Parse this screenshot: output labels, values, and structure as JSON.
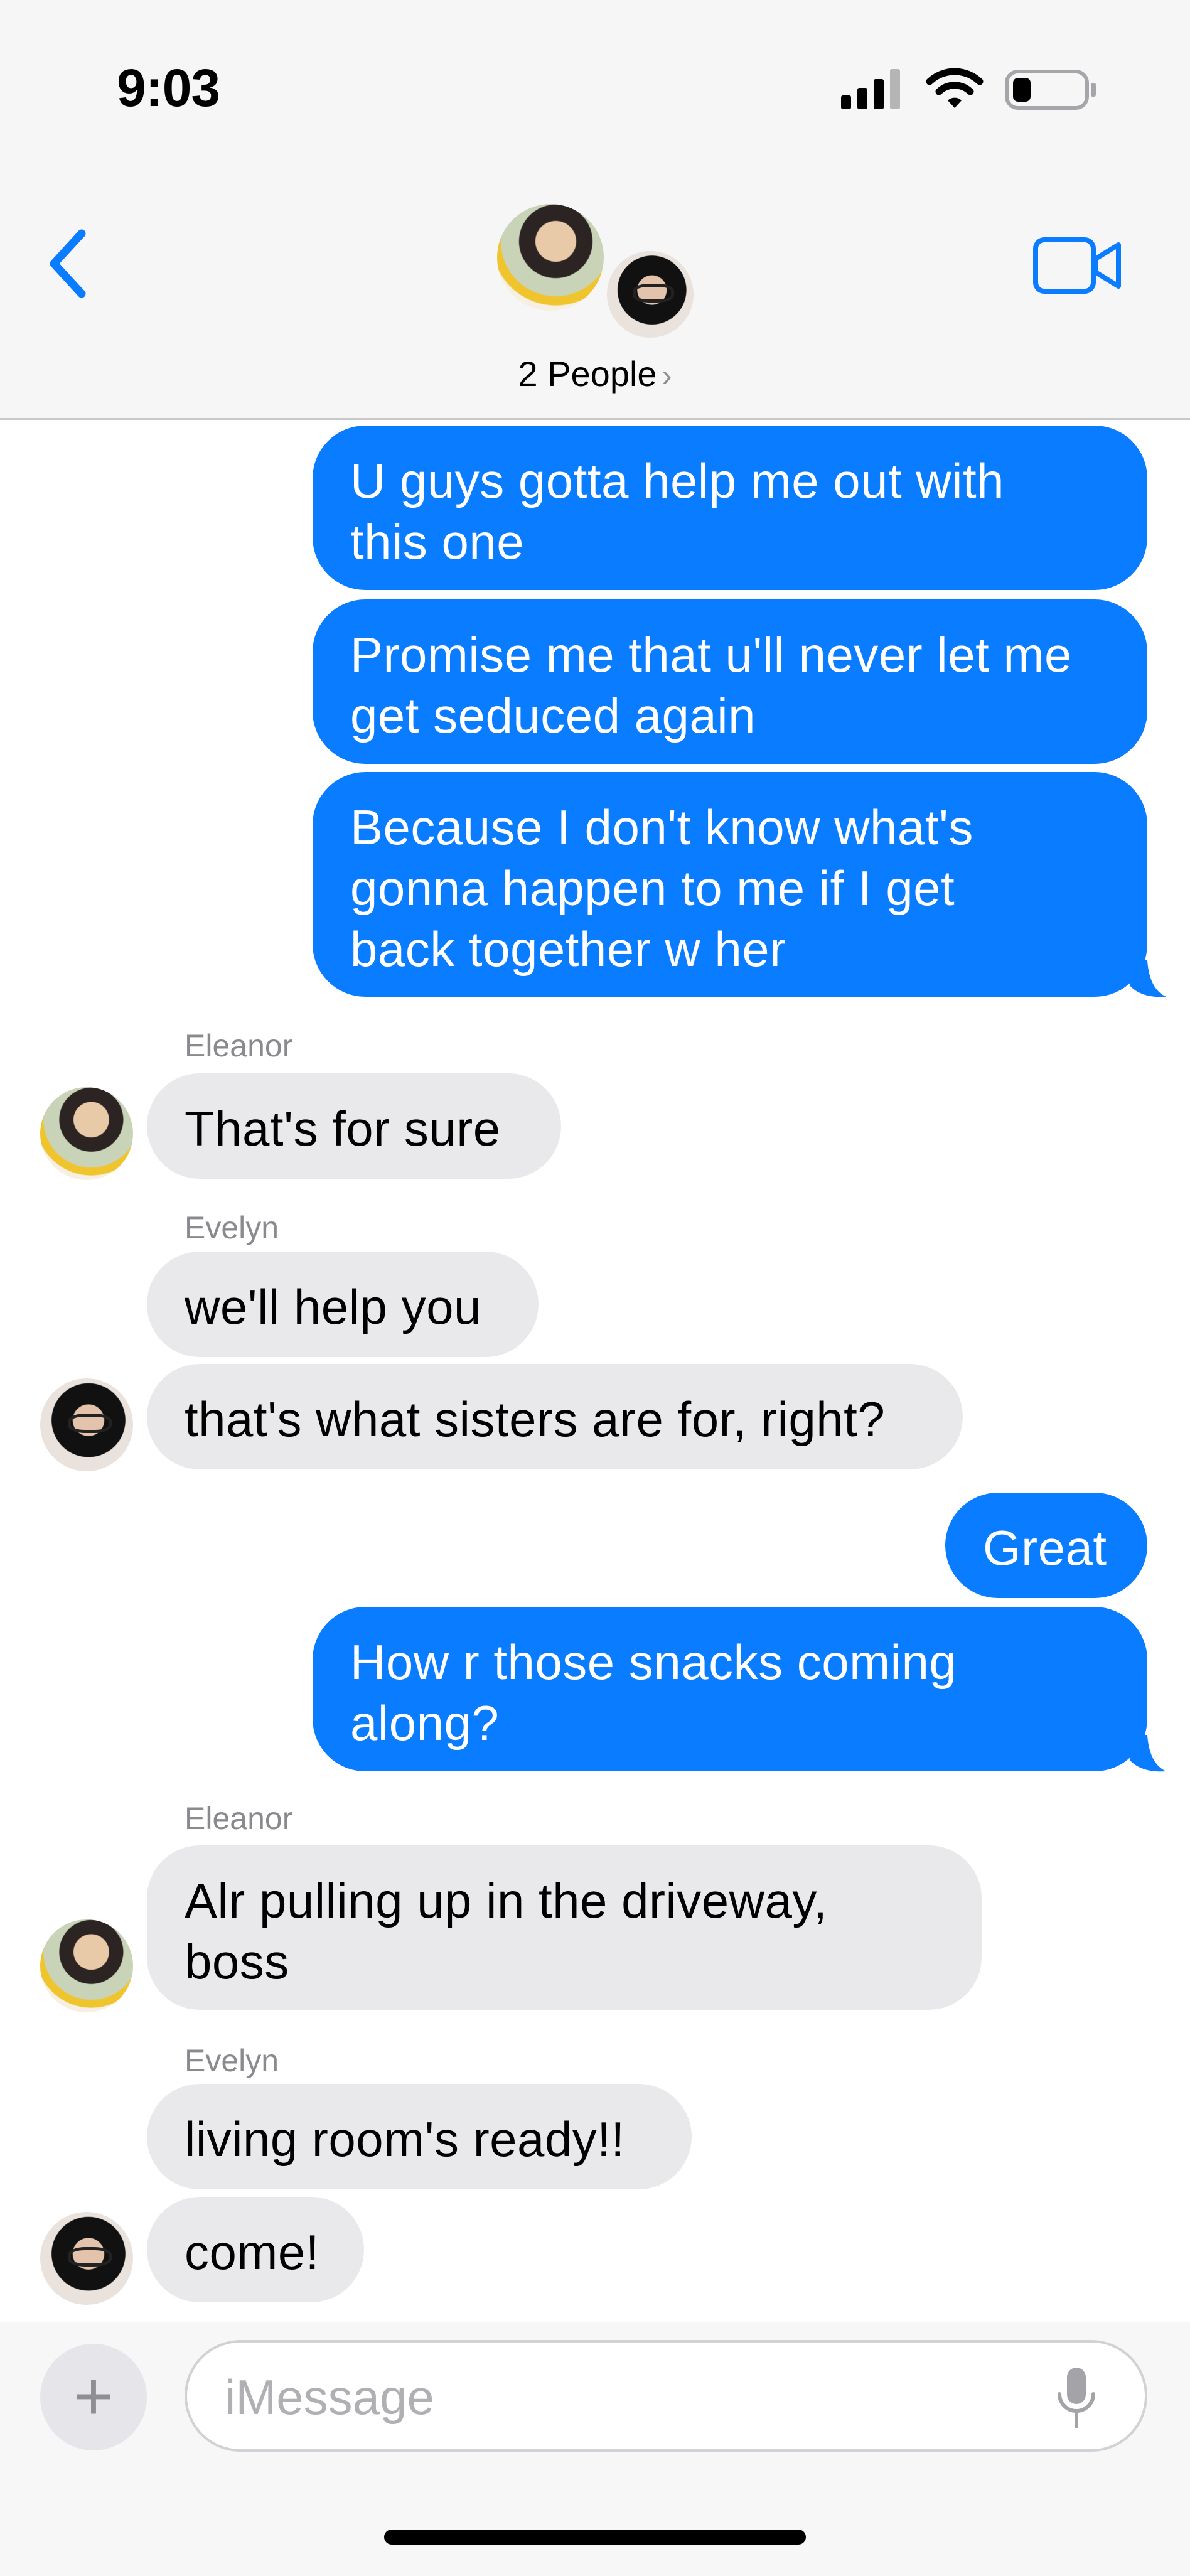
{
  "status_bar": {
    "time": "9:03"
  },
  "header": {
    "people_label": "2 People",
    "chevron": "›"
  },
  "messages": [
    {
      "from": "me",
      "lines": [
        "U guys gotta help me out with",
        "this one"
      ]
    },
    {
      "from": "me",
      "lines": [
        "Promise me that u'll never let me",
        "get seduced again"
      ]
    },
    {
      "from": "me",
      "lines": [
        "Because I don't know what's",
        "gonna happen to me if I get",
        "back together w her"
      ]
    },
    {
      "from": "Eleanor",
      "sender": "Eleanor",
      "lines": [
        "That's for sure"
      ]
    },
    {
      "from": "Evelyn",
      "sender": "Evelyn",
      "lines": [
        "we'll help you"
      ]
    },
    {
      "from": "Evelyn",
      "lines": [
        "that's what sisters are for, right?"
      ]
    },
    {
      "from": "me",
      "lines": [
        "Great"
      ]
    },
    {
      "from": "me",
      "lines": [
        "How r those snacks coming",
        "along?"
      ]
    },
    {
      "from": "Eleanor",
      "sender": "Eleanor",
      "lines": [
        "Alr pulling up in the driveway,",
        "boss"
      ]
    },
    {
      "from": "Evelyn",
      "sender": "Evelyn",
      "lines": [
        "living room's ready!!"
      ]
    },
    {
      "from": "Evelyn",
      "lines": [
        "come!"
      ]
    }
  ],
  "input": {
    "placeholder": "iMessage",
    "plus": "+"
  },
  "colors": {
    "outgoing": "#0a7cff",
    "incoming": "#e9e9eb",
    "accent": "#0a7cff"
  }
}
